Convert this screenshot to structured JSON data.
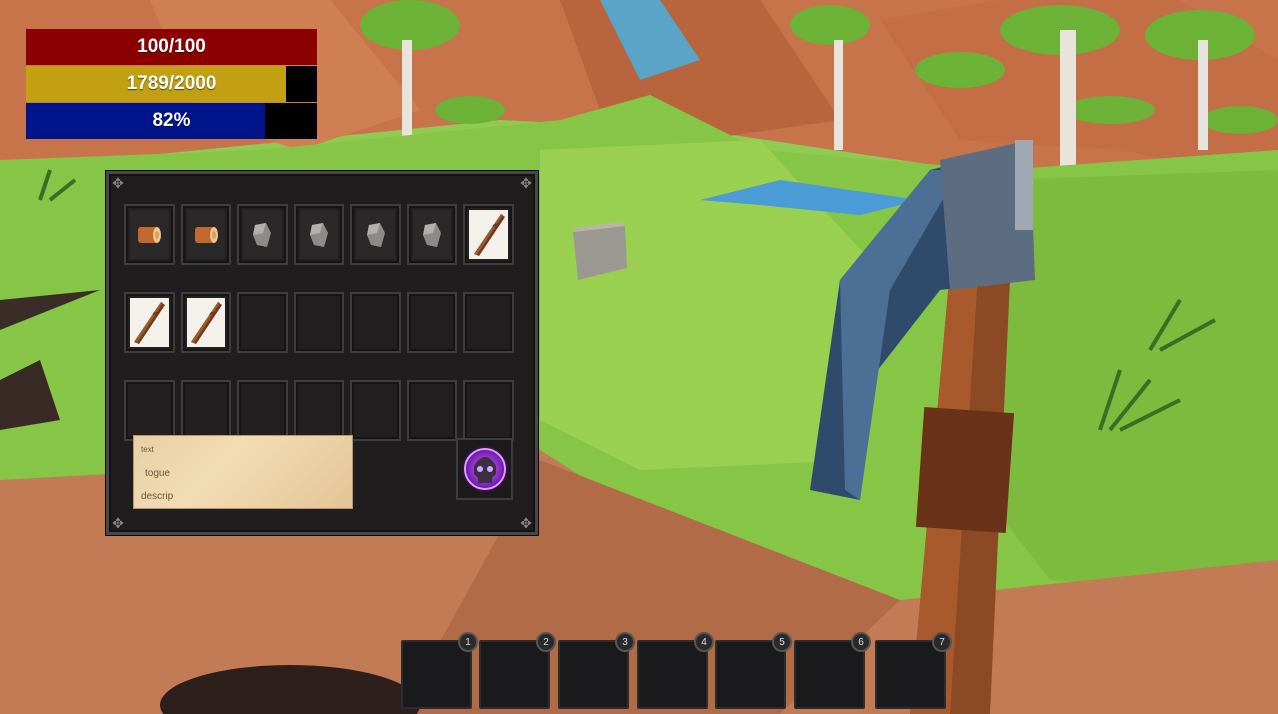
{
  "hud": {
    "health": {
      "label": "100/100",
      "fraction": 1.0,
      "color": "#8b0000"
    },
    "stamina": {
      "label": "1789/2000",
      "fraction": 0.8945,
      "color": "#c2a012"
    },
    "mana": {
      "label": "82%",
      "fraction": 0.82,
      "color": "#00148c"
    }
  },
  "inventory": {
    "rows": [
      [
        "wood",
        "wood",
        "stone",
        "stone",
        "stone",
        "stone",
        "stick"
      ],
      [
        "stick",
        "stick",
        "empty",
        "empty",
        "empty",
        "empty",
        "empty"
      ],
      [
        "empty",
        "empty",
        "empty",
        "empty",
        "empty",
        "empty",
        "empty"
      ]
    ],
    "description": {
      "line1": "text",
      "line2": "togue",
      "line3": "descrip"
    },
    "special_slot_icon": "purple-skull-icon"
  },
  "hotbar": {
    "slots": [
      "1",
      "2",
      "3",
      "4",
      "5",
      "6",
      "7"
    ]
  },
  "equipped_item_icon": "pickaxe-icon"
}
